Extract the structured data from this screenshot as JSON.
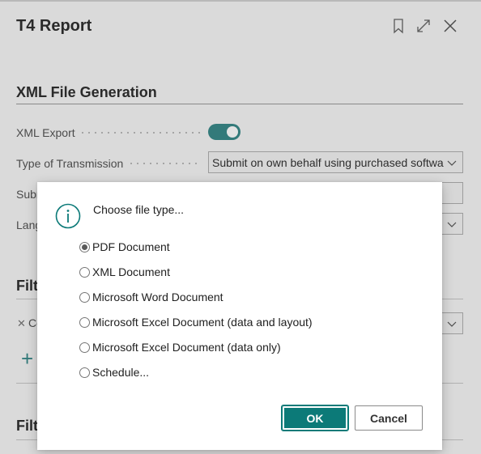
{
  "page": {
    "title": "T4 Report",
    "header_icons": [
      "bookmark-icon",
      "expand-icon",
      "close-icon"
    ]
  },
  "section": {
    "title": "XML File Generation",
    "fields": {
      "xml_export_label": "XML Export",
      "xml_export_on": true,
      "type_of_transmission_label": "Type of Transmission",
      "type_of_transmission_value": "Submit on own behalf using purchased softwa",
      "submission_label_partial": "Subm",
      "language_label_partial": "Lang"
    }
  },
  "background_fragments": {
    "filter1_title_partial": "Filte",
    "filter_chip_partial": "Co",
    "filter2_title_partial": "Filte"
  },
  "dialog": {
    "prompt": "Choose file type...",
    "options": [
      {
        "label": "PDF Document",
        "checked": true
      },
      {
        "label": "XML Document",
        "checked": false
      },
      {
        "label": "Microsoft Word Document",
        "checked": false
      },
      {
        "label": "Microsoft Excel Document (data and layout)",
        "checked": false
      },
      {
        "label": "Microsoft Excel Document (data only)",
        "checked": false
      },
      {
        "label": "Schedule...",
        "checked": false
      }
    ],
    "ok_label": "OK",
    "cancel_label": "Cancel"
  },
  "colors": {
    "accent": "#0c7a78",
    "toggle": "#3a8a8a"
  }
}
